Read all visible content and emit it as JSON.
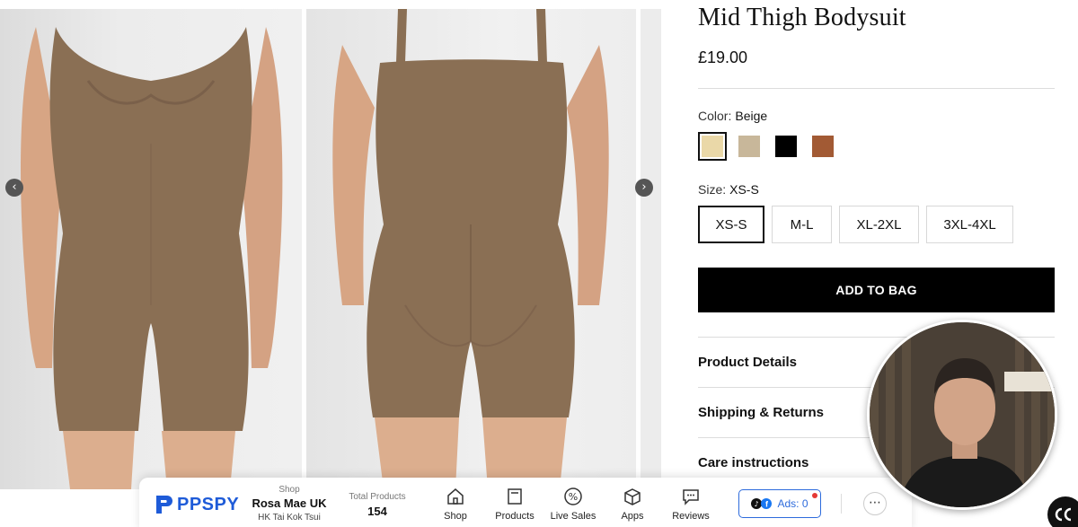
{
  "product": {
    "title": "Mid Thigh Bodysuit",
    "price": "£19.00",
    "color_label": "Color:",
    "color_value": "Beige",
    "size_label": "Size:",
    "size_value": "XS-S",
    "swatches": [
      {
        "name": "Beige",
        "color": "#ead8a8",
        "selected": true
      },
      {
        "name": "Taupe",
        "color": "#c8b79a",
        "selected": false
      },
      {
        "name": "Black",
        "color": "#000000",
        "selected": false
      },
      {
        "name": "Brown",
        "color": "#a25a34",
        "selected": false
      }
    ],
    "sizes": [
      {
        "label": "XS-S",
        "selected": true
      },
      {
        "label": "M-L",
        "selected": false
      },
      {
        "label": "XL-2XL",
        "selected": false
      },
      {
        "label": "3XL-4XL",
        "selected": false
      }
    ],
    "add_to_bag": "ADD TO BAG",
    "accordions": [
      "Product Details",
      "Shipping & Returns",
      "Care instructions"
    ]
  },
  "gallery": {
    "prev_icon": "chevron-left-icon",
    "next_icon": "chevron-right-icon",
    "garment_color": "#8a6f54"
  },
  "ppspy": {
    "logo_text": "PPSPY",
    "shop_caption": "Shop",
    "shop_name": "Rosa Mae UK",
    "shop_location": "HK Tai Kok Tsui",
    "total_caption": "Total Products",
    "total_value": "154",
    "nav": [
      {
        "label": "Shop",
        "icon": "shop-icon"
      },
      {
        "label": "Products",
        "icon": "products-icon"
      },
      {
        "label": "Live Sales",
        "icon": "percent-icon"
      },
      {
        "label": "Apps",
        "icon": "box-icon"
      },
      {
        "label": "Reviews",
        "icon": "chat-icon"
      }
    ],
    "ads_label": "Ads: 0",
    "more_glyph": "⋯",
    "brand_color": "#1e5bd8"
  },
  "prev_glyph": "‹",
  "next_glyph": "›"
}
